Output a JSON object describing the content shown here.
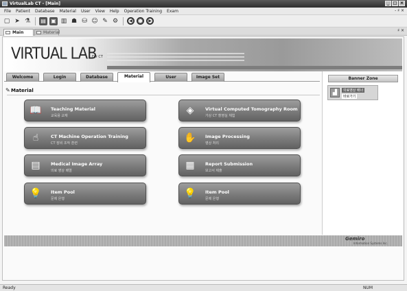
{
  "window": {
    "title": "VirtualLab CT - [Main]"
  },
  "menu": [
    "File",
    "Patient",
    "Database",
    "Material",
    "User",
    "View",
    "Help",
    "Operation Training",
    "Exam"
  ],
  "menu_right": "- ♯ ×",
  "doc_tabs": [
    {
      "label": "Main"
    },
    {
      "label": "Material"
    }
  ],
  "doc_tab_pin": "♯ ×",
  "banner": {
    "logo": "VIRTUAL LAB",
    "logo_sub": "For CT"
  },
  "tabs": [
    {
      "label": "Welcome"
    },
    {
      "label": "Login"
    },
    {
      "label": "Database"
    },
    {
      "label": "Material",
      "active": true
    },
    {
      "label": "User"
    },
    {
      "label": "Image Set"
    }
  ],
  "section": {
    "title": "Material",
    "icon": "pencil-icon"
  },
  "menu_buttons": [
    {
      "title": "Teaching Material",
      "subtitle": "교육용 교재",
      "icon": "book-icon"
    },
    {
      "title": "Virtual Computed Tomography Room",
      "subtitle": "가상 CT 촬영실 체험",
      "icon": "diamond-icon"
    },
    {
      "title": "CT Machine Operation Training",
      "subtitle": "CT 장비 조작 훈련",
      "icon": "hand-icon"
    },
    {
      "title": "Image Processing",
      "subtitle": "영상 처리",
      "icon": "hands-icon"
    },
    {
      "title": "Medical Image Array",
      "subtitle": "의료 영상 배열",
      "icon": "document-icon"
    },
    {
      "title": "Report Submission",
      "subtitle": "보고서 제출",
      "icon": "report-icon"
    },
    {
      "title": "Item Pool",
      "subtitle": "문제 은행",
      "icon": "lightbulb-icon"
    },
    {
      "title": "Item Pool",
      "subtitle": "문제 은행",
      "icon": "lightbulb-icon"
    }
  ],
  "banner_zone": {
    "title": "Banner Zone",
    "card_line1": "의료영상 배너",
    "card_line2": "바로가기"
  },
  "footer": {
    "logo": "Gemiro",
    "sub": "Information Systems Inc."
  },
  "status": {
    "left": "Ready",
    "right": "NUM"
  }
}
